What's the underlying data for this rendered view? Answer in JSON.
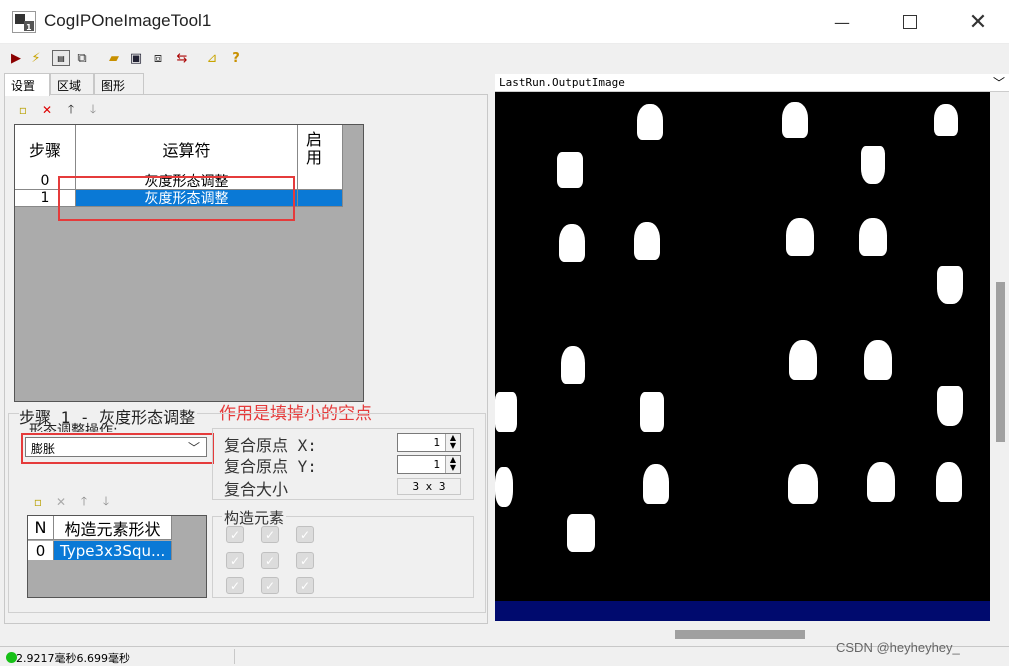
{
  "window": {
    "title": "CogIPOneImageTool1"
  },
  "tabs": [
    {
      "label": "设置",
      "active": true
    },
    {
      "label": "区域",
      "active": false
    },
    {
      "label": "图形",
      "active": false
    }
  ],
  "toolbar": {
    "icons": [
      "run-icon",
      "electric-icon",
      "show-last-run-icon",
      "show-train-icon",
      "open-icon",
      "save-icon",
      "reset-icon",
      "link-icon",
      "measure-icon",
      "help-icon"
    ]
  },
  "operators_grid": {
    "headers": {
      "step": "步骤",
      "operator": "运算符",
      "enabled": "启用"
    },
    "rows": [
      {
        "step": "0",
        "operator": "灰度形态调整",
        "selected": false
      },
      {
        "step": "1",
        "operator": "灰度形态调整",
        "selected": true
      }
    ]
  },
  "annotation": "作用是填掉小的空点",
  "step_panel": {
    "title": "步骤 1 - 灰度形态调整",
    "operation_label": "形态调整操作:",
    "operation_value": "膨胀",
    "composite_x_label": "复合原点 X:",
    "composite_x_value": "1",
    "composite_y_label": "复合原点 Y:",
    "composite_y_value": "1",
    "composite_size_label": "复合大小",
    "composite_size_value": "3 x 3",
    "structuring_element_title": "构造元素",
    "se_grid": {
      "headers": {
        "n": "N",
        "shape": "构造元素形状"
      },
      "rows": [
        {
          "n": "0",
          "shape": "Type3x3Squ..."
        }
      ]
    }
  },
  "image_display": {
    "title": "LastRun.OutputImage"
  },
  "status": {
    "text": "2.9217毫秒6.699毫秒",
    "status_color": "#17c017"
  },
  "watermark": "CSDN @heyheyhey_"
}
